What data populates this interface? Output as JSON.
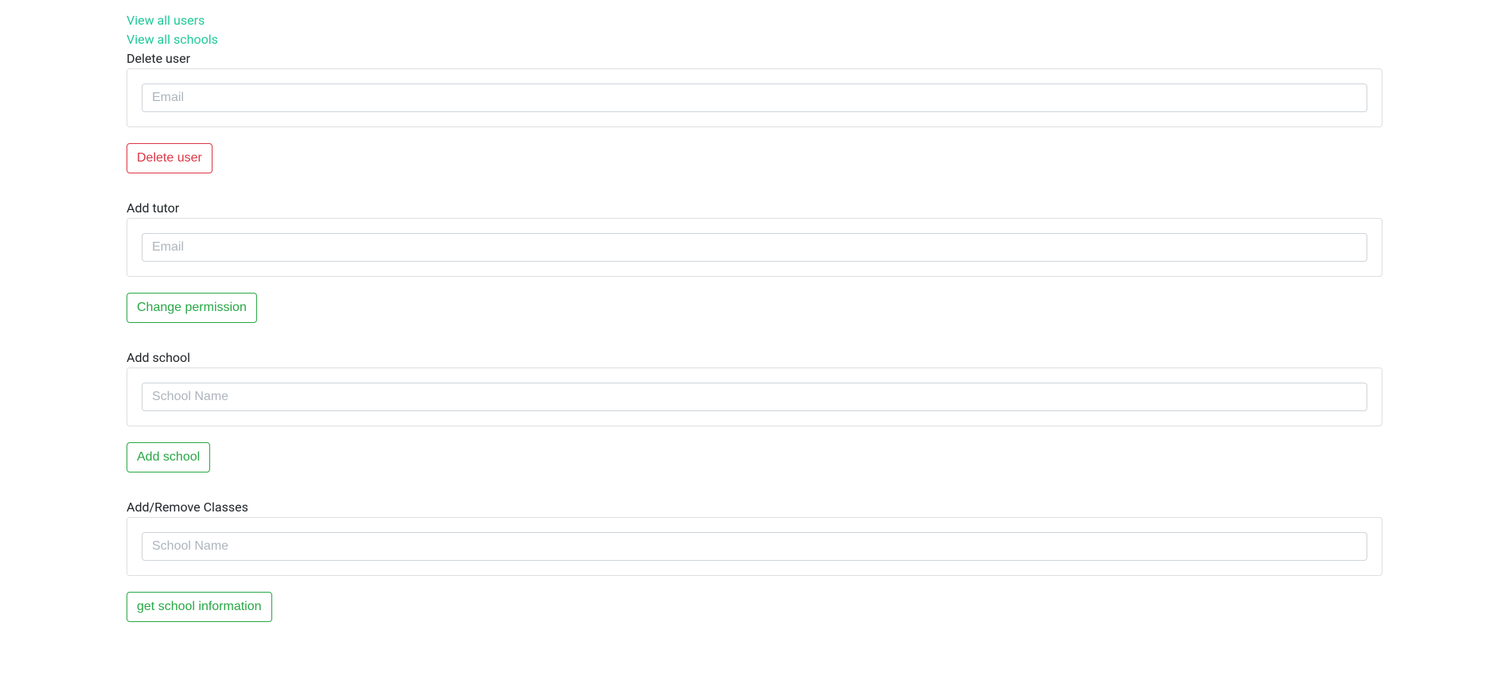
{
  "links": {
    "view_all_users": "View all users",
    "view_all_schools": "View all schools"
  },
  "delete_user": {
    "label": "Delete user",
    "placeholder": "Email",
    "button": "Delete user"
  },
  "add_tutor": {
    "label": "Add tutor",
    "placeholder": "Email",
    "button": "Change permission"
  },
  "add_school": {
    "label": "Add school",
    "placeholder": "School Name",
    "button": "Add school"
  },
  "add_remove_classes": {
    "label": "Add/Remove Classes",
    "placeholder": "School Name",
    "button": "get school information"
  }
}
